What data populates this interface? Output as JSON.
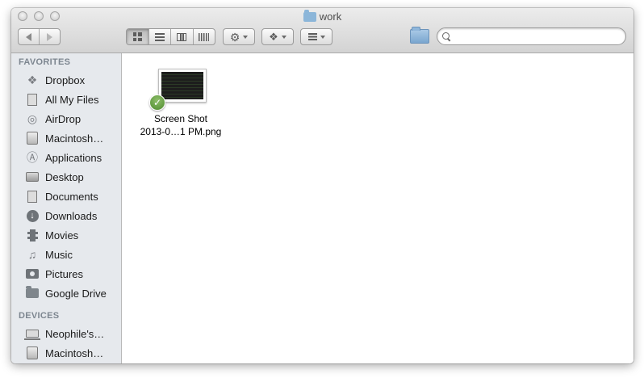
{
  "window": {
    "title": "work"
  },
  "toolbar": {
    "view_modes": [
      "icon",
      "list",
      "column",
      "cover-flow"
    ],
    "active_view": "icon",
    "search": {
      "value": "",
      "placeholder": ""
    }
  },
  "sidebar": {
    "favorites_header": "FAVORITES",
    "favorites": [
      {
        "label": "Dropbox",
        "icon": "dropbox-icon"
      },
      {
        "label": "All My Files",
        "icon": "all-my-files-icon"
      },
      {
        "label": "AirDrop",
        "icon": "airdrop-icon"
      },
      {
        "label": "Macintosh…",
        "icon": "hard-disk-icon"
      },
      {
        "label": "Applications",
        "icon": "applications-icon"
      },
      {
        "label": "Desktop",
        "icon": "desktop-icon"
      },
      {
        "label": "Documents",
        "icon": "documents-icon"
      },
      {
        "label": "Downloads",
        "icon": "downloads-icon"
      },
      {
        "label": "Movies",
        "icon": "movies-icon"
      },
      {
        "label": "Music",
        "icon": "music-icon"
      },
      {
        "label": "Pictures",
        "icon": "pictures-icon"
      },
      {
        "label": "Google Drive",
        "icon": "folder-icon"
      }
    ],
    "devices_header": "DEVICES",
    "devices": [
      {
        "label": "Neophile's…",
        "icon": "laptop-icon"
      },
      {
        "label": "Macintosh…",
        "icon": "hard-disk-icon"
      }
    ]
  },
  "content": {
    "files": [
      {
        "line1": "Screen Shot",
        "line2": "2013-0…1 PM.png",
        "sync_status": "synced"
      }
    ]
  },
  "colors": {
    "sidebar_bg": "#e6e9ed",
    "section_header": "#7d8690",
    "sync_badge": "#5b9a3a"
  }
}
